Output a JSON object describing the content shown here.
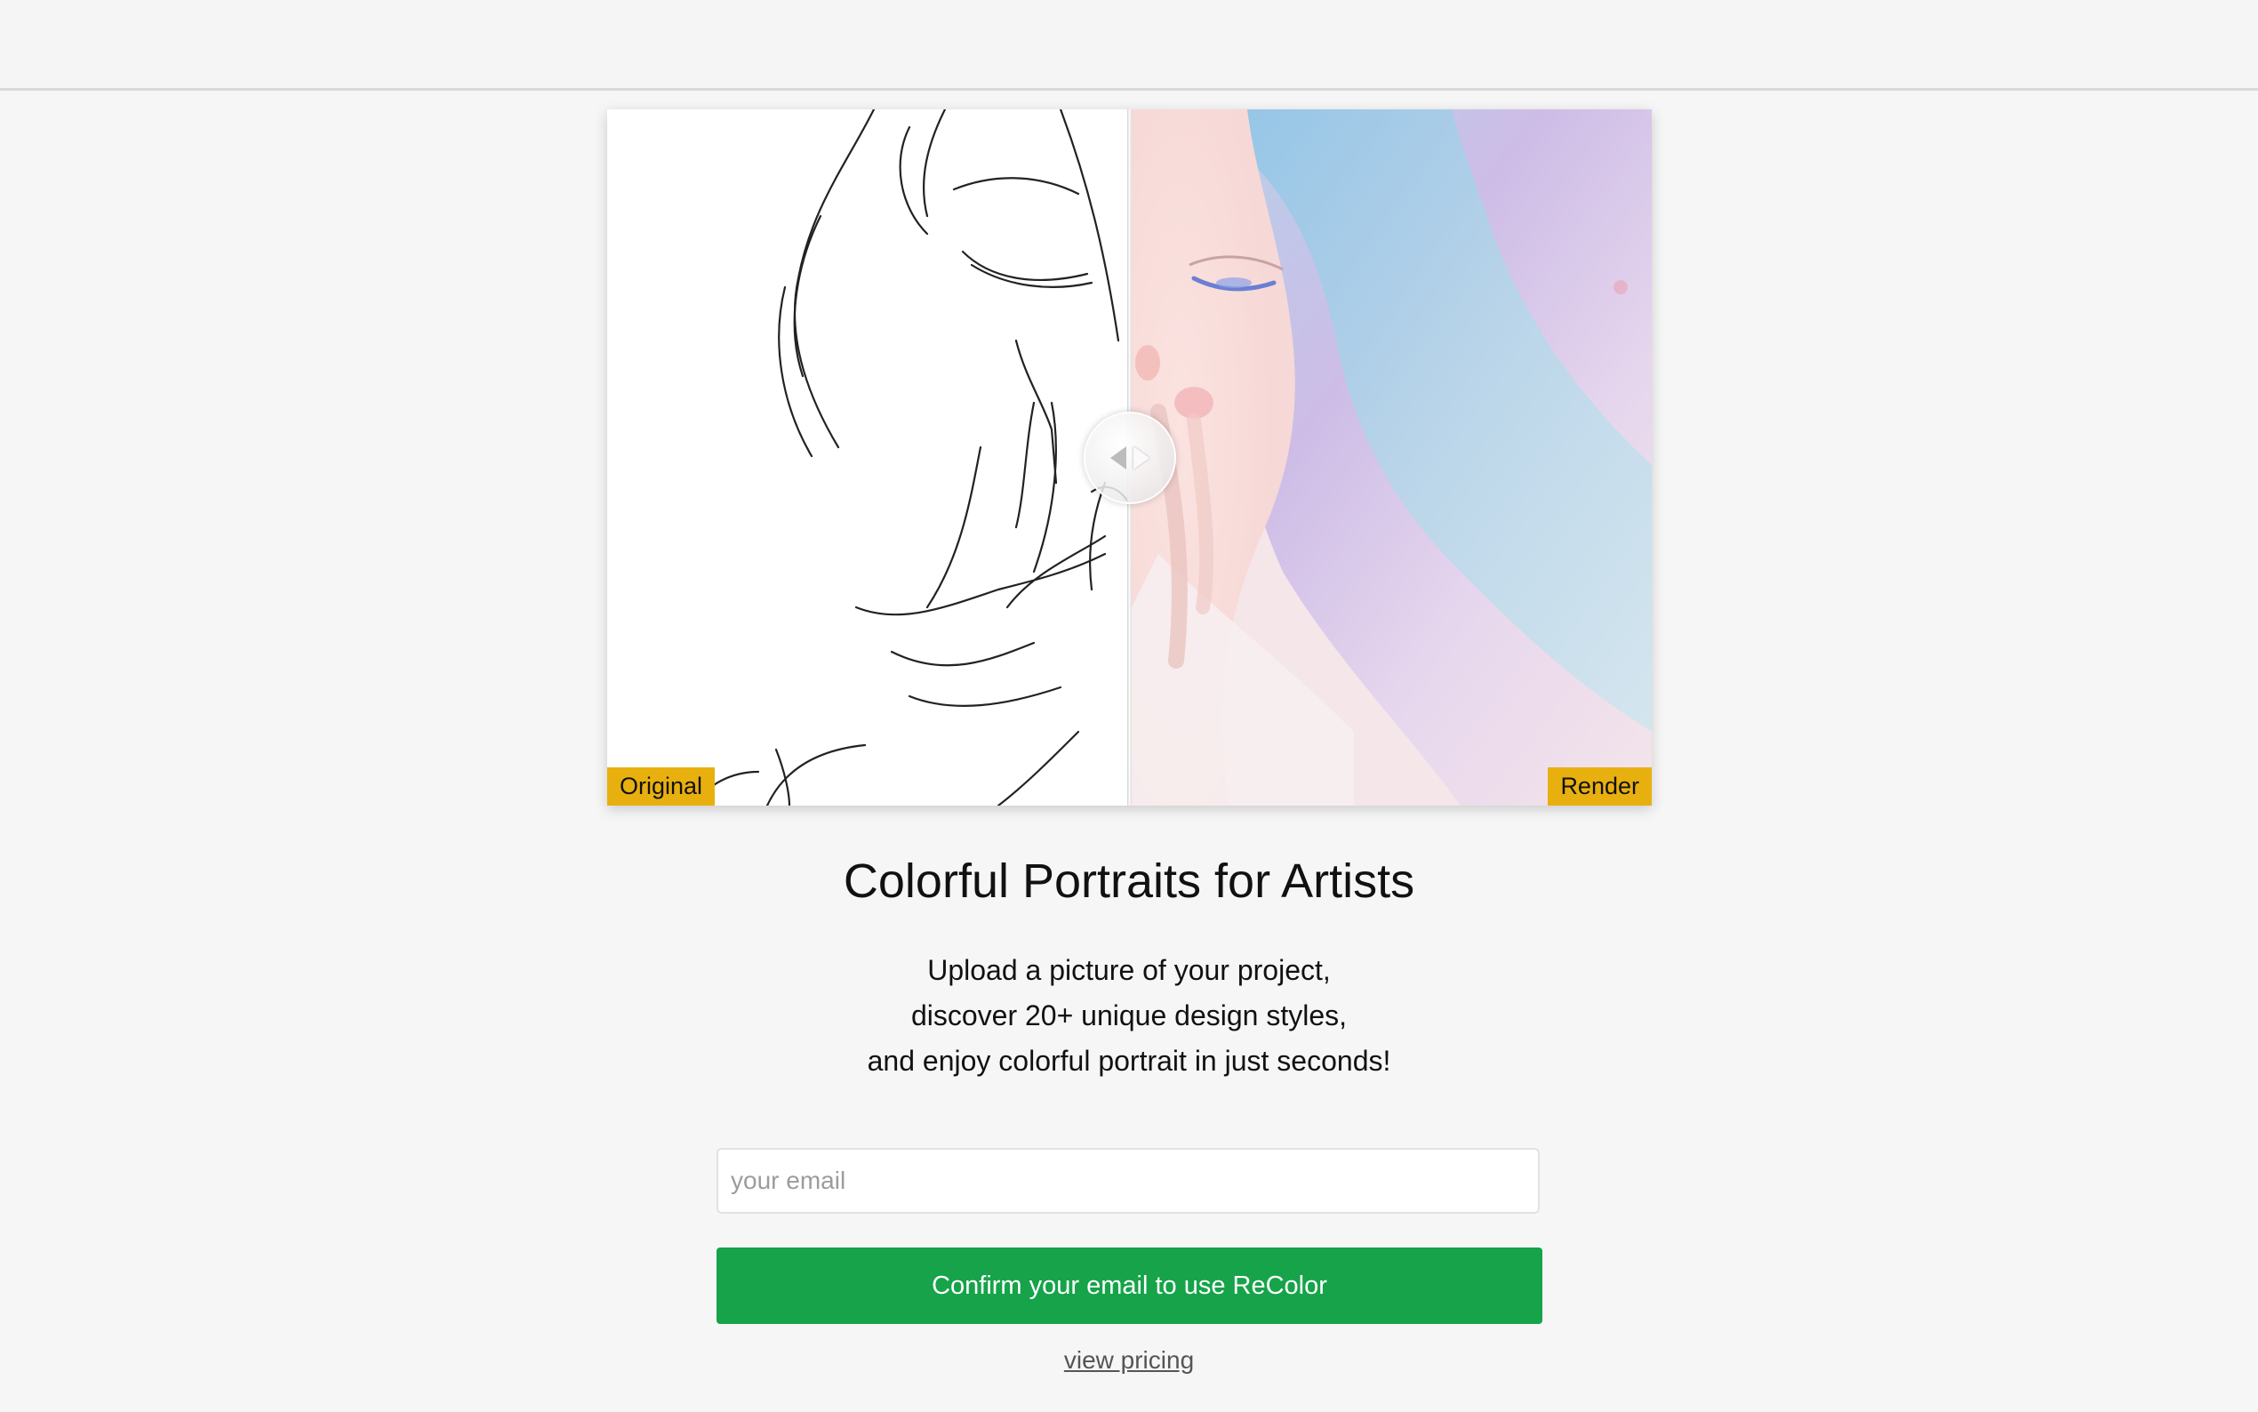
{
  "compare": {
    "left_tag": "Original",
    "right_tag": "Render",
    "handle": "compare-slider-handle"
  },
  "hero": {
    "title": "Colorful Portraits for Artists",
    "subtitle_lines": [
      "Upload a picture of your project,",
      "discover 20+ unique design styles,",
      "and enjoy colorful portrait in just seconds!"
    ]
  },
  "form": {
    "email_placeholder": "your email",
    "email_value": "",
    "confirm_label": "Confirm your email to use ReColor",
    "pricing_link": "view pricing"
  },
  "colors": {
    "tag_bg": "#e8b00f",
    "button_bg": "#16a34a",
    "page_bg": "#f6f6f6"
  },
  "icons": {
    "handle_arrows": "left-right-arrows-icon"
  }
}
